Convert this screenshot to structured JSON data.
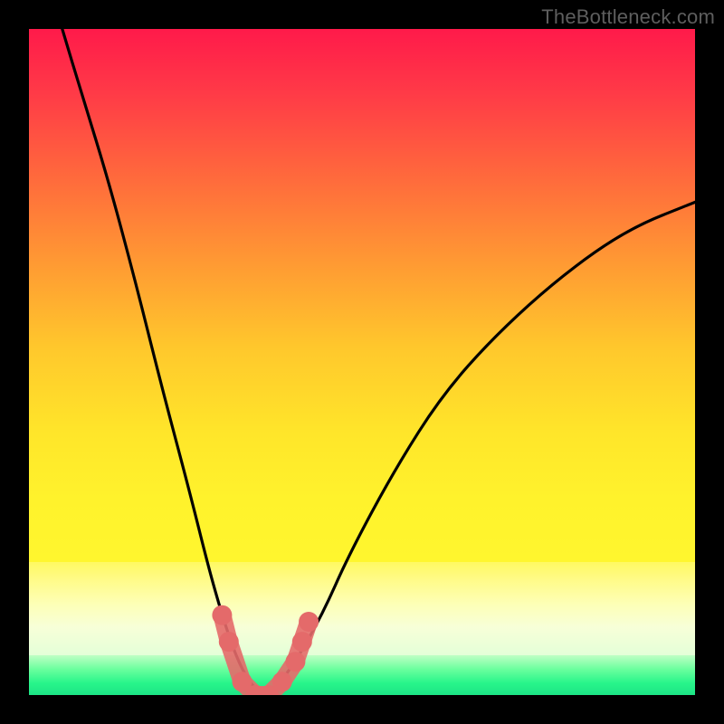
{
  "watermark": "TheBottleneck.com",
  "chart_data": {
    "type": "line",
    "title": "",
    "xlabel": "",
    "ylabel": "",
    "xlim": [
      0,
      100
    ],
    "ylim": [
      0,
      100
    ],
    "background_gradient": {
      "stops": [
        {
          "pos": 0.0,
          "color": "#ff1a4a"
        },
        {
          "pos": 0.4,
          "color": "#ff8a36"
        },
        {
          "pos": 0.7,
          "color": "#ffe62a"
        },
        {
          "pos": 0.88,
          "color": "#fdffb6"
        },
        {
          "pos": 0.96,
          "color": "#6bff9e"
        },
        {
          "pos": 1.0,
          "color": "#1de486"
        }
      ]
    },
    "series": [
      {
        "name": "bottleneck-curve",
        "color": "#000000",
        "x": [
          5,
          8,
          12,
          16,
          20,
          24,
          27,
          29,
          31,
          33,
          35,
          37,
          40,
          44,
          48,
          55,
          62,
          70,
          80,
          90,
          100
        ],
        "y": [
          100,
          90,
          77,
          62,
          46,
          31,
          19,
          12,
          6,
          2,
          0,
          1,
          5,
          12,
          21,
          34,
          45,
          54,
          63,
          70,
          74
        ]
      }
    ],
    "markers": {
      "name": "trough-markers",
      "color": "#e46a6a",
      "points": [
        {
          "x": 29,
          "y": 12
        },
        {
          "x": 30,
          "y": 8
        },
        {
          "x": 32,
          "y": 2
        },
        {
          "x": 34,
          "y": 0
        },
        {
          "x": 36,
          "y": 0
        },
        {
          "x": 38,
          "y": 2
        },
        {
          "x": 40,
          "y": 5
        },
        {
          "x": 41,
          "y": 8
        },
        {
          "x": 42,
          "y": 11
        }
      ]
    }
  }
}
